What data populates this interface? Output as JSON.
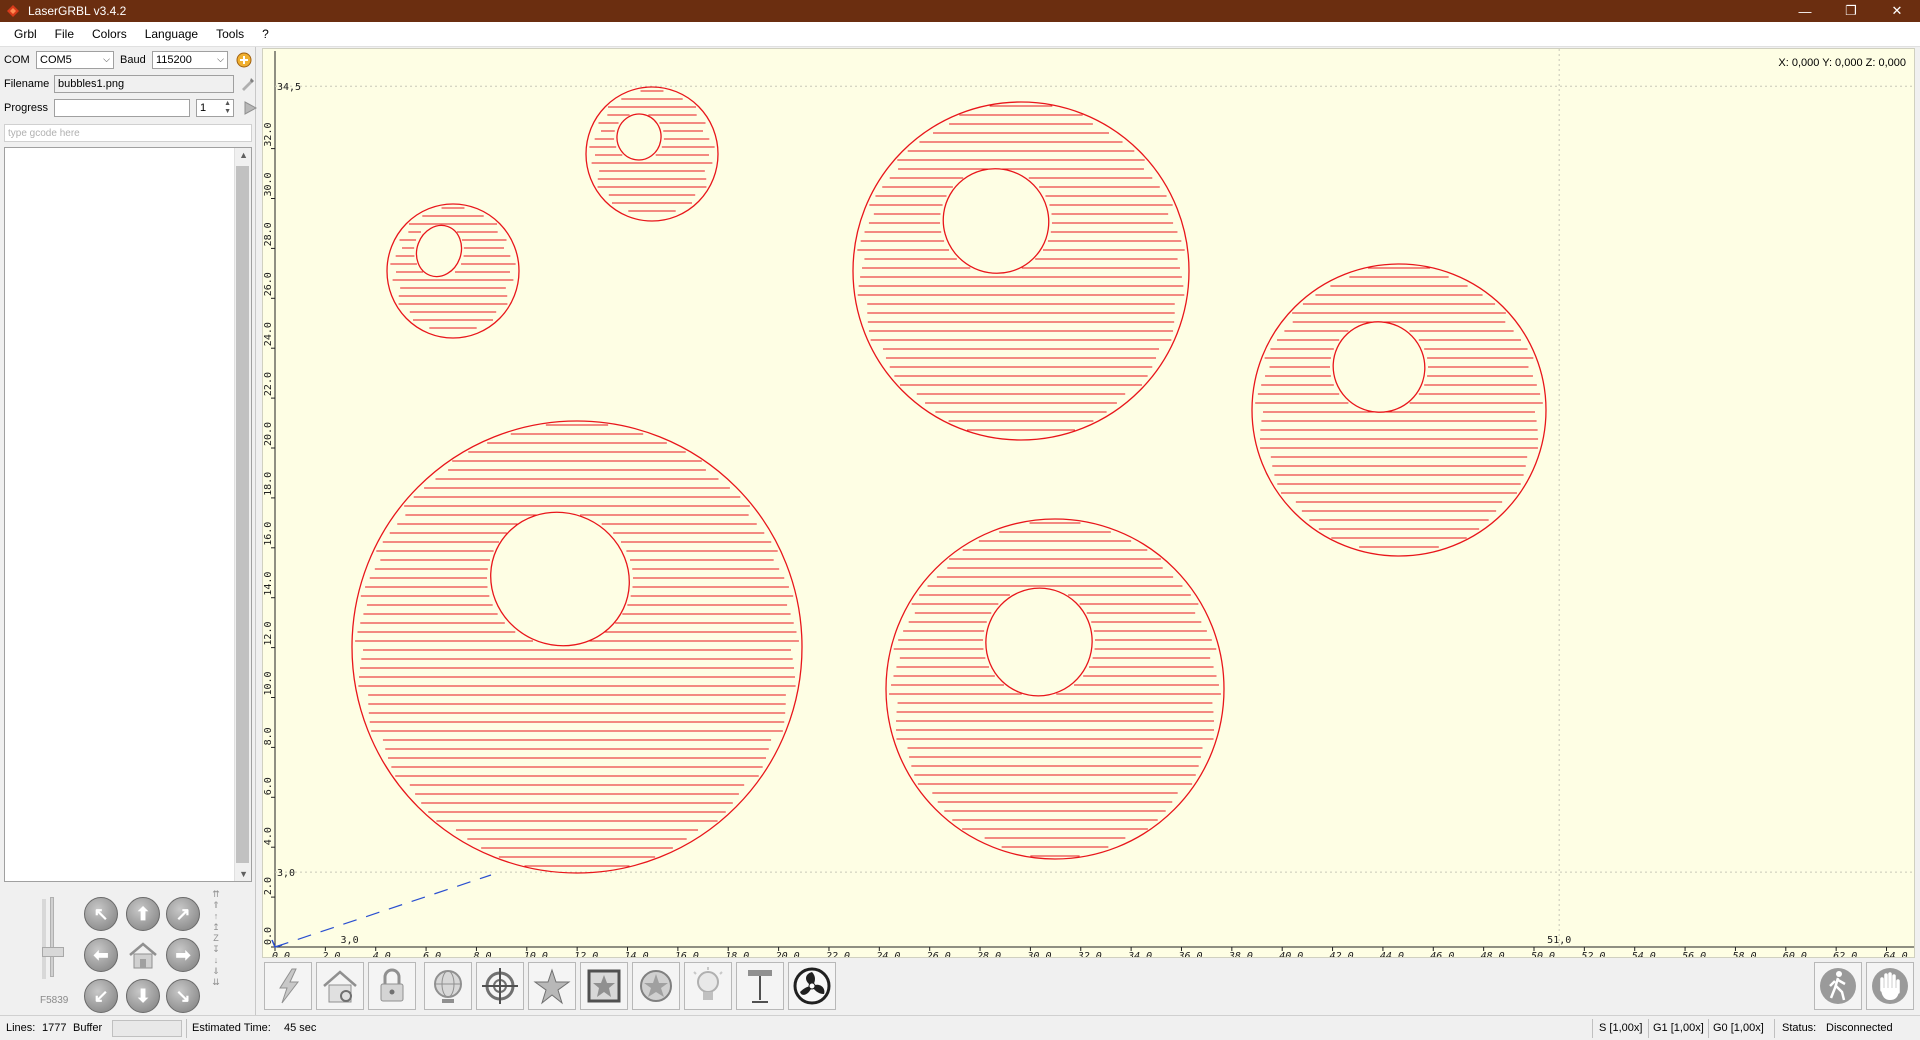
{
  "window": {
    "title": "LaserGRBL v3.4.2",
    "minimize": "—",
    "maximize": "❐",
    "close": "✕"
  },
  "menu": [
    "Grbl",
    "File",
    "Colors",
    "Language",
    "Tools",
    "?"
  ],
  "connection": {
    "com_label": "COM",
    "com_value": "COM5",
    "baud_label": "Baud",
    "baud_value": "115200"
  },
  "file": {
    "filename_label": "Filename",
    "filename_value": "bubbles1.png",
    "progress_label": "Progress",
    "progress_value": "",
    "passes_value": "1"
  },
  "gcode_input": {
    "placeholder": "type gcode here"
  },
  "jog": {
    "feed_label": "F5839",
    "z_label": "Z"
  },
  "canvas": {
    "coords": "X: 0,000 Y: 0,000 Z: 0,000",
    "x_ticks": [
      "0.0",
      "2.0",
      "4.0",
      "6.0",
      "8.0",
      "10.0",
      "12.0",
      "14.0",
      "16.0",
      "18.0",
      "20.0",
      "22.0",
      "24.0",
      "26.0",
      "28.0",
      "30.0",
      "32.0",
      "34.0",
      "36.0",
      "38.0",
      "40.0",
      "42.0",
      "44.0",
      "46.0",
      "48.0",
      "50.0",
      "52.0",
      "54.0",
      "56.0",
      "58.0",
      "60.0",
      "62.0",
      "64.0"
    ],
    "y_ticks": [
      "0.0",
      "2.0",
      "4.0",
      "6.0",
      "8.0",
      "10.0",
      "12.0",
      "14.0",
      "16.0",
      "18.0",
      "20.0",
      "22.0",
      "24.0",
      "26.0",
      "28.0",
      "30.0",
      "32.0"
    ],
    "bounds": {
      "x_min": "3,0",
      "x_max": "51,0",
      "y_min": "3,0",
      "y_max": "34,5"
    },
    "colors": {
      "background": "#fefee4",
      "engrave": "#e8161b",
      "travel": "#2a4fd0"
    }
  },
  "toolbar": {
    "buttons": [
      "lightning-icon",
      "home-scan-icon",
      "lock-icon",
      "globe-icon",
      "crosshair-icon",
      "star-icon",
      "frame-icon",
      "wheel-icon",
      "bulb-icon",
      "focus-icon",
      "fan-icon"
    ],
    "right_buttons": [
      "walk-icon",
      "hand-stop-icon"
    ]
  },
  "status": {
    "lines_label": "Lines:",
    "lines_value": "1777",
    "buffer_label": "Buffer",
    "estimated_label": "Estimated Time:",
    "estimated_value": "45 sec",
    "s_override": "S [1,00x]",
    "g1_override": "G1 [1,00x]",
    "g0_override": "G0 [1,00x]",
    "status_label": "Status:",
    "status_value": "Disconnected"
  }
}
